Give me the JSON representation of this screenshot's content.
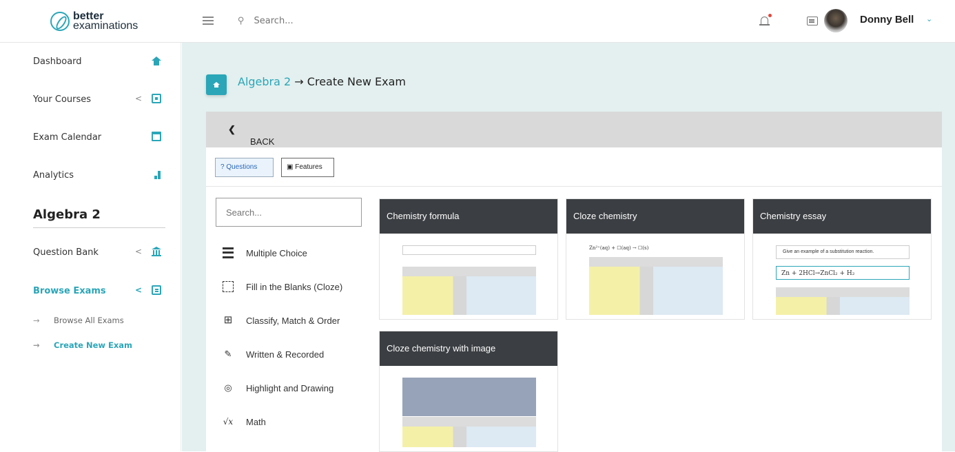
{
  "header": {
    "logo_line1": "better",
    "logo_line2": "examinations",
    "search_placeholder": "Search...",
    "user_name": "Donny Bell"
  },
  "sidebar": {
    "items": [
      {
        "label": "Dashboard"
      },
      {
        "label": "Your Courses",
        "arrow": "<"
      },
      {
        "label": "Exam Calendar"
      },
      {
        "label": "Analytics"
      }
    ],
    "section_title": "Algebra 2",
    "section_items": [
      {
        "label": "Question Bank",
        "arrow": "<"
      },
      {
        "label": "Browse Exams",
        "arrow": "<"
      }
    ],
    "sub_items": [
      {
        "label": "Browse All Exams",
        "bullet": "→"
      },
      {
        "label": "Create New Exam",
        "bullet": "→"
      }
    ]
  },
  "breadcrumb": {
    "course": "Algebra 2",
    "separator": "→",
    "page": "Create New Exam"
  },
  "back_label": "BACK",
  "tabs": {
    "questions": "Questions",
    "questions_glyph": "?",
    "features": "Features"
  },
  "question_search_placeholder": "Search...",
  "question_types": [
    {
      "label": "Multiple Choice",
      "icon": "list-icon"
    },
    {
      "label": "Fill in the Blanks (Cloze)",
      "icon": "dashed-box-icon"
    },
    {
      "label": "Classify, Match & Order",
      "icon": "grid-icon"
    },
    {
      "label": "Written & Recorded",
      "icon": "pencil-icon",
      "glyph": "✎"
    },
    {
      "label": "Highlight and Drawing",
      "icon": "target-icon",
      "glyph": "◎"
    },
    {
      "label": "Math",
      "icon": "sqrt-icon",
      "glyph": "√x"
    }
  ],
  "cards": [
    {
      "title": "Chemistry formula"
    },
    {
      "title": "Cloze chemistry",
      "preview_text": "Zn²⁺(aq) + ☐(aq) → ☐(s)"
    },
    {
      "title": "Chemistry essay",
      "preview_text": "Give an example of a substitution reaction.",
      "preview_formula": "Zn + 2HCl→ZnCl₂ + H₂"
    },
    {
      "title": "Cloze chemistry with image"
    }
  ],
  "colors": {
    "accent": "#2aa6b8",
    "card_header": "#3b3e42",
    "main_bg": "#e3f0ef",
    "back_bar": "#d9d9d9"
  }
}
